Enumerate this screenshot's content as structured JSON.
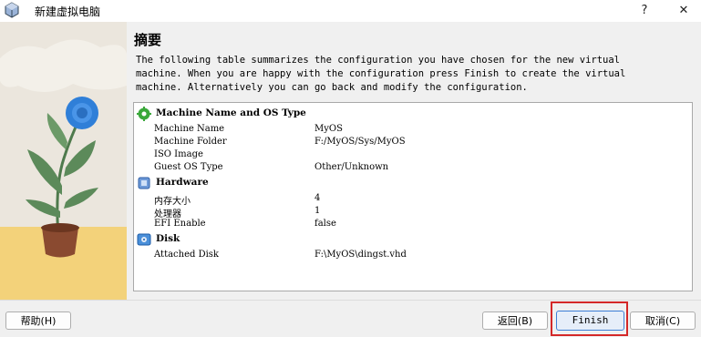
{
  "window": {
    "title": "新建虚拟电脑",
    "help_symbol": "?",
    "close_symbol": "✕"
  },
  "icons": {
    "app": "virtualbox-cube-icon",
    "general": "green-gear-icon",
    "hardware": "chip-icon",
    "disk": "hard-disk-icon"
  },
  "page": {
    "heading": "摘要",
    "description_lines": [
      "The following table summarizes the configuration you have chosen for the new virtual",
      "machine. When you are happy with the configuration press Finish to create the virtual",
      "machine. Alternatively you can go back and modify the configuration."
    ]
  },
  "summary": {
    "general": {
      "title": "Machine Name and OS Type",
      "rows": [
        {
          "label": "Machine Name",
          "value": "MyOS"
        },
        {
          "label": "Machine Folder",
          "value": "F:/MyOS/Sys/MyOS"
        },
        {
          "label": "ISO Image",
          "value": ""
        },
        {
          "label": "Guest OS Type",
          "value": "Other/Unknown"
        }
      ]
    },
    "hardware": {
      "title": "Hardware",
      "rows": [
        {
          "label": "内存大小",
          "value": "4"
        },
        {
          "label": "处理器",
          "value": "1"
        },
        {
          "label": "EFI Enable",
          "value": "false"
        }
      ]
    },
    "disk": {
      "title": "Disk",
      "rows": [
        {
          "label": "Attached Disk",
          "value": "F:\\MyOS\\dingst.vhd"
        }
      ]
    }
  },
  "buttons": {
    "help": "帮助(H)",
    "back": "返回(B)",
    "finish": "Finish",
    "cancel": "取消(C)"
  },
  "colors": {
    "finish_highlight": "#d42828",
    "flower": "#2f7fd8",
    "leaves": "#5c8a5a",
    "pot": "#8a4a30"
  }
}
